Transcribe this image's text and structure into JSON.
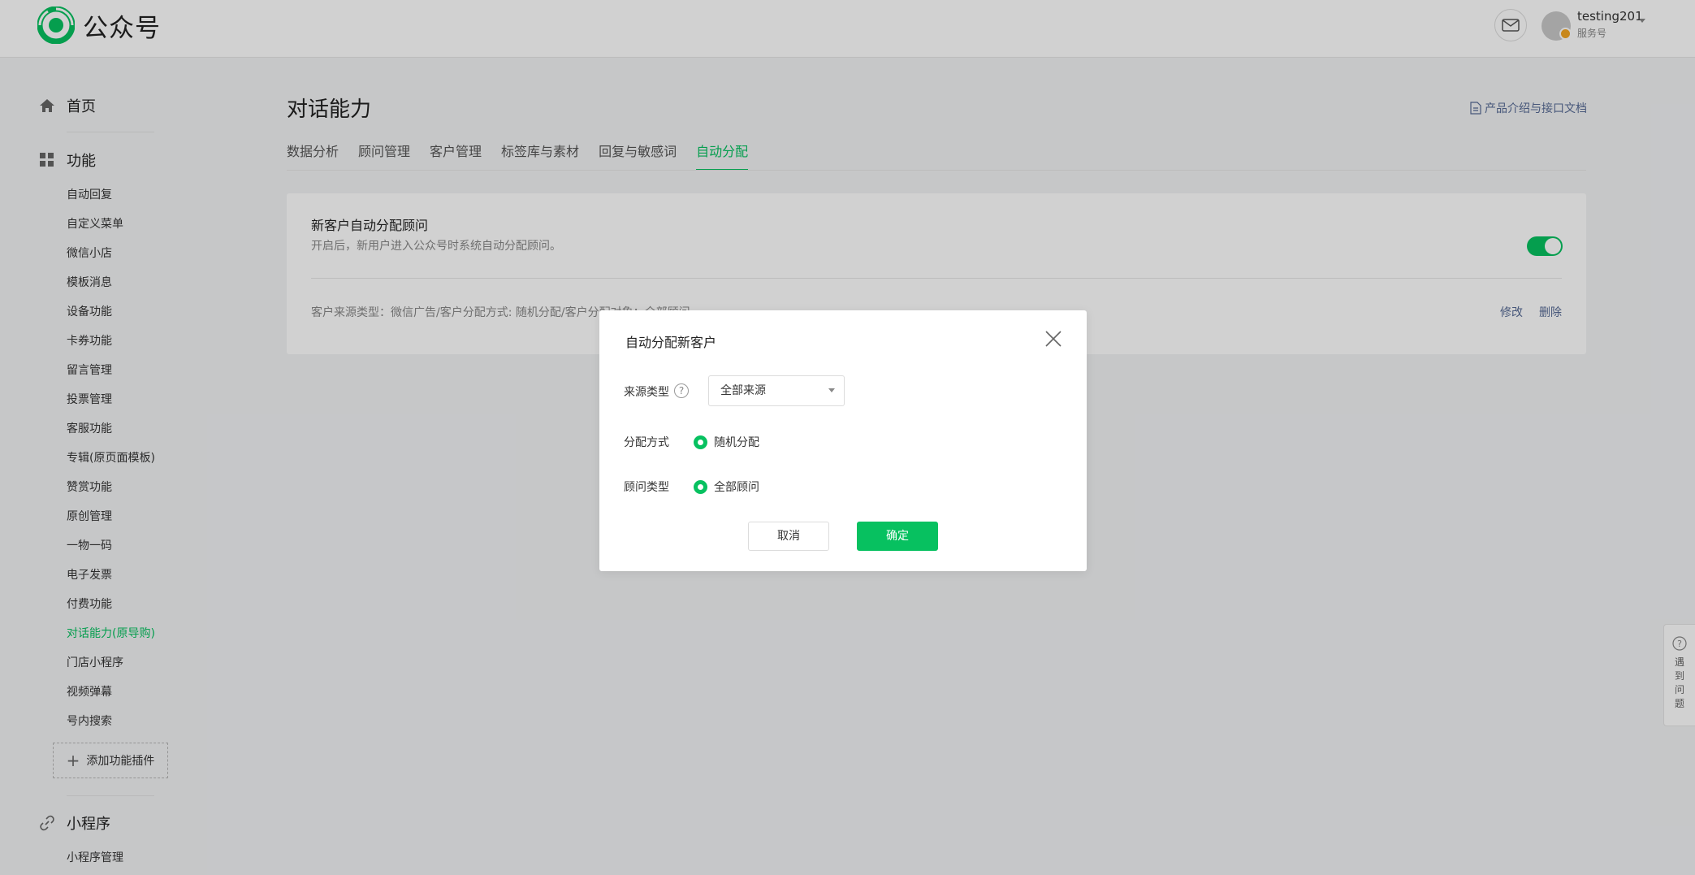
{
  "header": {
    "logo_text": "公众号",
    "user_name": "testing201",
    "user_type": "服务号"
  },
  "sidebar": {
    "home_label": "首页",
    "func_label": "功能",
    "items": [
      {
        "label": "自动回复",
        "active": false
      },
      {
        "label": "自定义菜单",
        "active": false
      },
      {
        "label": "微信小店",
        "active": false
      },
      {
        "label": "模板消息",
        "active": false
      },
      {
        "label": "设备功能",
        "active": false
      },
      {
        "label": "卡券功能",
        "active": false
      },
      {
        "label": "留言管理",
        "active": false
      },
      {
        "label": "投票管理",
        "active": false
      },
      {
        "label": "客服功能",
        "active": false
      },
      {
        "label": "专辑(原页面模板)",
        "active": false
      },
      {
        "label": "赞赏功能",
        "active": false
      },
      {
        "label": "原创管理",
        "active": false
      },
      {
        "label": "一物一码",
        "active": false
      },
      {
        "label": "电子发票",
        "active": false
      },
      {
        "label": "付费功能",
        "active": false
      },
      {
        "label": "对话能力(原导购)",
        "active": true
      },
      {
        "label": "门店小程序",
        "active": false
      },
      {
        "label": "视频弹幕",
        "active": false
      },
      {
        "label": "号内搜索",
        "active": false
      }
    ],
    "add_plugin_label": "添加功能插件",
    "mini_label": "小程序",
    "mini_items": [
      "小程序管理"
    ]
  },
  "main": {
    "title": "对话能力",
    "doc_link": "产品介绍与接口文档",
    "tabs": [
      {
        "label": "数据分析",
        "active": false
      },
      {
        "label": "顾问管理",
        "active": false
      },
      {
        "label": "客户管理",
        "active": false
      },
      {
        "label": "标签库与素材",
        "active": false
      },
      {
        "label": "回复与敏感词",
        "active": false
      },
      {
        "label": "自动分配",
        "active": true
      }
    ],
    "card": {
      "title": "新客户自动分配顾问",
      "desc": "开启后，新用户进入公众号时系统自动分配顾问。",
      "toggle_on": true,
      "rule": "客户来源类型：微信广告/客户分配方式: 随机分配/客户分配对象：全部顾问",
      "edit_label": "修改",
      "delete_label": "删除"
    }
  },
  "feedback": {
    "label": "遇到问题"
  },
  "dialog": {
    "title": "自动分配新客户",
    "source_label": "来源类型",
    "source_value": "全部来源",
    "method_label": "分配方式",
    "method_value": "随机分配",
    "advisor_label": "顾问类型",
    "advisor_value": "全部顾问",
    "cancel_label": "取消",
    "ok_label": "确定"
  },
  "colors": {
    "accent": "#07c160",
    "link": "#576b95"
  }
}
